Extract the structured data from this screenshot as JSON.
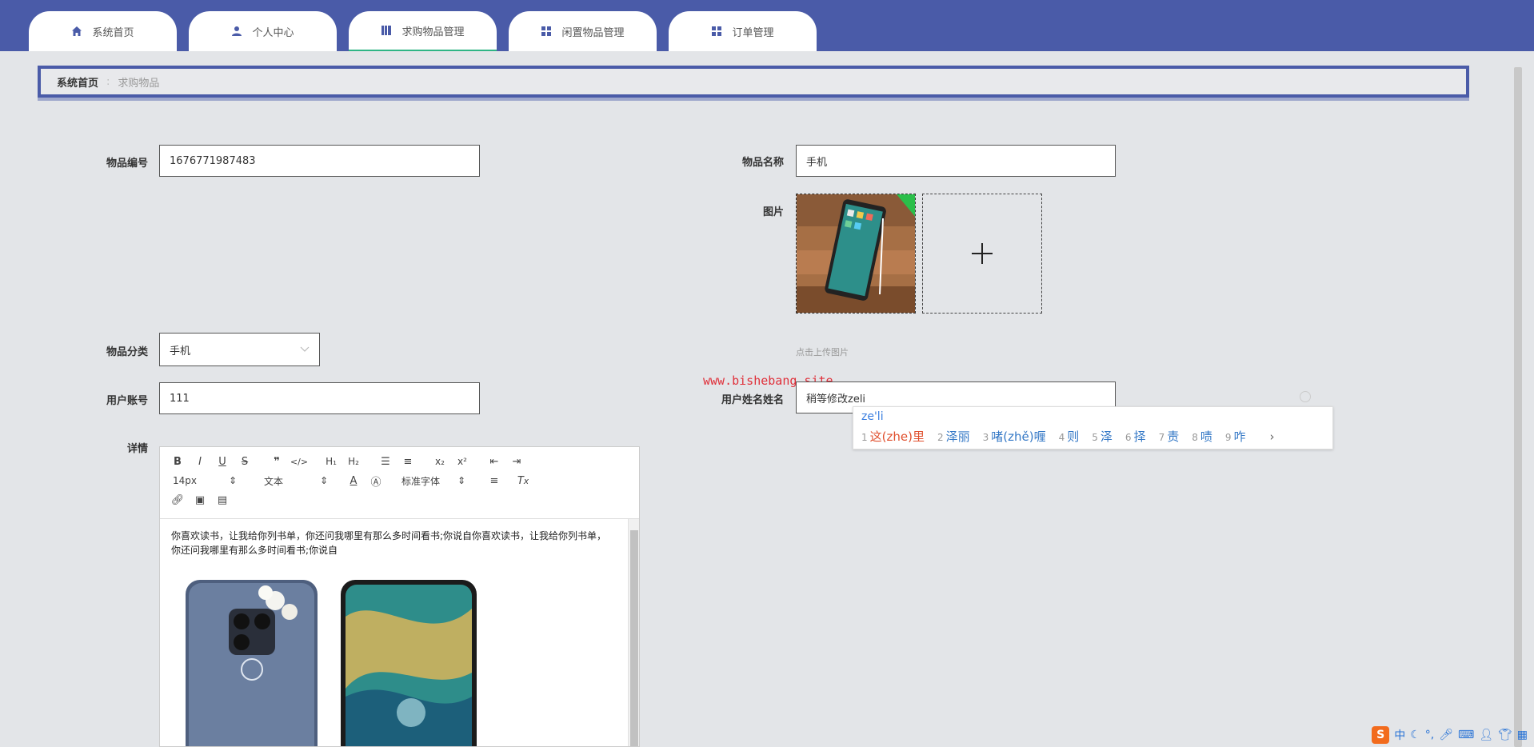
{
  "nav": {
    "tabs": [
      {
        "label": "系统首页",
        "icon": "home-icon"
      },
      {
        "label": "个人中心",
        "icon": "user-icon"
      },
      {
        "label": "求购物品管理",
        "icon": "bookmark-icon",
        "active": true
      },
      {
        "label": "闲置物品管理",
        "icon": "grid-icon"
      },
      {
        "label": "订单管理",
        "icon": "grid-icon"
      }
    ]
  },
  "breadcrumb": {
    "home": "系统首页",
    "current": "求购物品"
  },
  "form": {
    "item_no_label": "物品编号",
    "item_no_value": "1676771987483",
    "item_name_label": "物品名称",
    "item_name_value": "手机",
    "image_label": "图片",
    "upload_hint": "点击上传图片",
    "category_label": "物品分类",
    "category_value": "手机",
    "account_label": "用户账号",
    "account_value": "111",
    "username_label": "用户姓名姓名",
    "username_value": "稍等修改zeli",
    "detail_label": "详情"
  },
  "editor": {
    "font_size": "14px",
    "block_type": "文本",
    "font_family": "标准字体",
    "text": "你喜欢读书，让我给你列书单，你还问我哪里有那么多时间看书;你说自你喜欢读书，让我给你列书单，你还问我哪里有那么多时间看书;你说自"
  },
  "watermark": "www.bishebang.site",
  "ime": {
    "pinyin": "ze'li",
    "candidates": [
      {
        "num": "1",
        "text": "这(zhe)里"
      },
      {
        "num": "2",
        "text": "泽丽"
      },
      {
        "num": "3",
        "text": "啫(zhě)喱"
      },
      {
        "num": "4",
        "text": "则"
      },
      {
        "num": "5",
        "text": "泽"
      },
      {
        "num": "6",
        "text": "择"
      },
      {
        "num": "7",
        "text": "责"
      },
      {
        "num": "8",
        "text": "啧"
      },
      {
        "num": "9",
        "text": "咋"
      }
    ],
    "tray_lang": "中"
  },
  "colors": {
    "nav_bg": "#4a5ba8",
    "page_bg": "#e3e5e8",
    "active_tab_underline": "#2fb585",
    "watermark": "#e0303a",
    "ime_candidate": "#3478c6"
  }
}
